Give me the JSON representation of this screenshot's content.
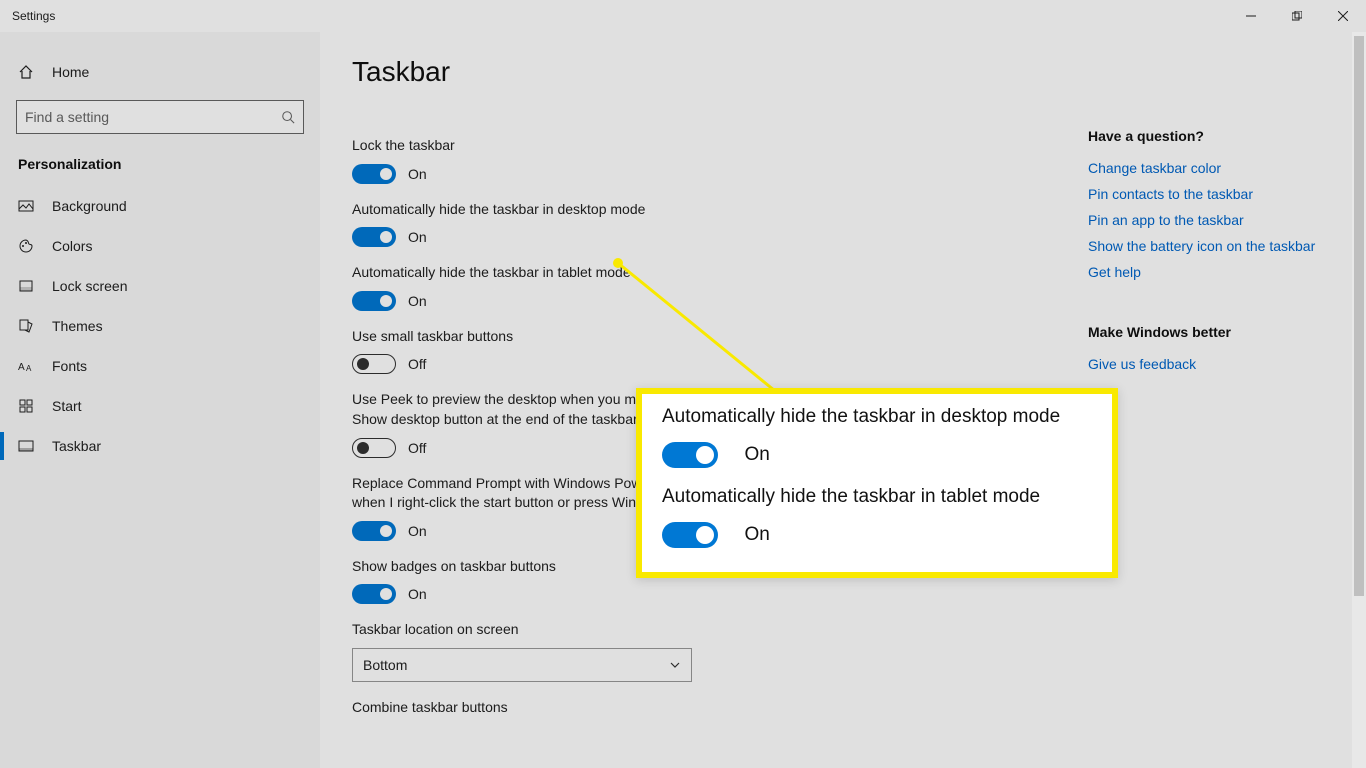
{
  "window": {
    "title": "Settings"
  },
  "sidebar": {
    "home": "Home",
    "search_placeholder": "Find a setting",
    "section": "Personalization",
    "items": [
      {
        "id": "background",
        "label": "Background"
      },
      {
        "id": "colors",
        "label": "Colors"
      },
      {
        "id": "lockscreen",
        "label": "Lock screen"
      },
      {
        "id": "themes",
        "label": "Themes"
      },
      {
        "id": "fonts",
        "label": "Fonts"
      },
      {
        "id": "start",
        "label": "Start"
      },
      {
        "id": "taskbar",
        "label": "Taskbar"
      }
    ]
  },
  "page": {
    "title": "Taskbar",
    "settings": [
      {
        "id": "lock",
        "label": "Lock the taskbar",
        "on": true,
        "state": "On"
      },
      {
        "id": "autohide_desktop",
        "label": "Automatically hide the taskbar in desktop mode",
        "on": true,
        "state": "On"
      },
      {
        "id": "autohide_tablet",
        "label": "Automatically hide the taskbar in tablet mode",
        "on": true,
        "state": "On"
      },
      {
        "id": "small_buttons",
        "label": "Use small taskbar buttons",
        "on": false,
        "state": "Off"
      },
      {
        "id": "peek",
        "label": "Use Peek to preview the desktop when you mov\nShow desktop button at the end of the taskbar",
        "on": false,
        "state": "Off"
      },
      {
        "id": "powershell",
        "label": "Replace Command Prompt with Windows Powe\nwhen I right-click the start button or press Winc",
        "on": true,
        "state": "On"
      },
      {
        "id": "badges",
        "label": "Show badges on taskbar buttons",
        "on": true,
        "state": "On"
      }
    ],
    "location": {
      "label": "Taskbar location on screen",
      "value": "Bottom"
    },
    "combine": {
      "label": "Combine taskbar buttons"
    }
  },
  "right": {
    "question": "Have a question?",
    "links": [
      "Change taskbar color",
      "Pin contacts to the taskbar",
      "Pin an app to the taskbar",
      "Show the battery icon on the taskbar",
      "Get help"
    ],
    "better": "Make Windows better",
    "feedback": "Give us feedback"
  },
  "callout": {
    "a": {
      "label": "Automatically hide the taskbar in desktop mode",
      "state": "On"
    },
    "b": {
      "label": "Automatically hide the taskbar in tablet mode",
      "state": "On"
    }
  }
}
